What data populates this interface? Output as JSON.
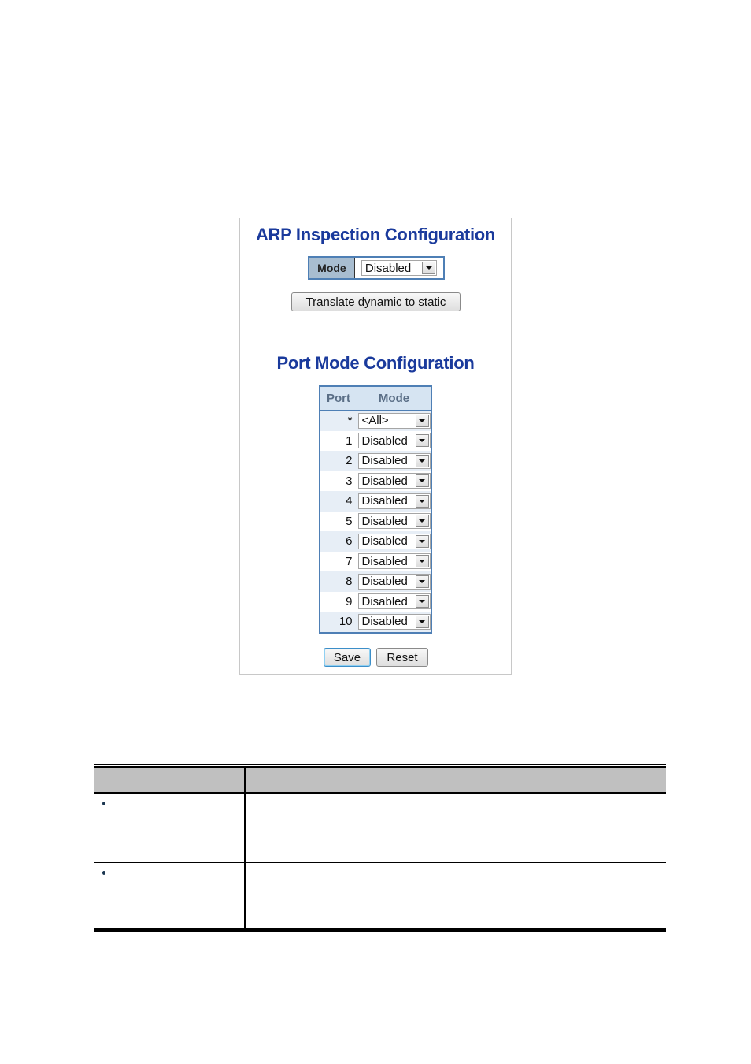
{
  "arp_inspection": {
    "title": "ARP Inspection Configuration",
    "mode_label": "Mode",
    "mode_value": "Disabled",
    "translate_button": "Translate dynamic to static"
  },
  "port_mode": {
    "title": "Port Mode Configuration",
    "columns": [
      "Port",
      "Mode"
    ],
    "rows": [
      {
        "port": "*",
        "mode": "<All>"
      },
      {
        "port": "1",
        "mode": "Disabled"
      },
      {
        "port": "2",
        "mode": "Disabled"
      },
      {
        "port": "3",
        "mode": "Disabled"
      },
      {
        "port": "4",
        "mode": "Disabled"
      },
      {
        "port": "5",
        "mode": "Disabled"
      },
      {
        "port": "6",
        "mode": "Disabled"
      },
      {
        "port": "7",
        "mode": "Disabled"
      },
      {
        "port": "8",
        "mode": "Disabled"
      },
      {
        "port": "9",
        "mode": "Disabled"
      },
      {
        "port": "10",
        "mode": "Disabled"
      }
    ]
  },
  "buttons": {
    "save": "Save",
    "reset": "Reset"
  },
  "colors": {
    "heading_blue": "#1a3a9c",
    "table_border": "#4e7fb5",
    "header_bg": "#d6e4f2",
    "mode_label_bg": "#a8bdd0",
    "alt_row_bg": "#e7eef6",
    "doc_header_bg": "#c0c0c0"
  }
}
